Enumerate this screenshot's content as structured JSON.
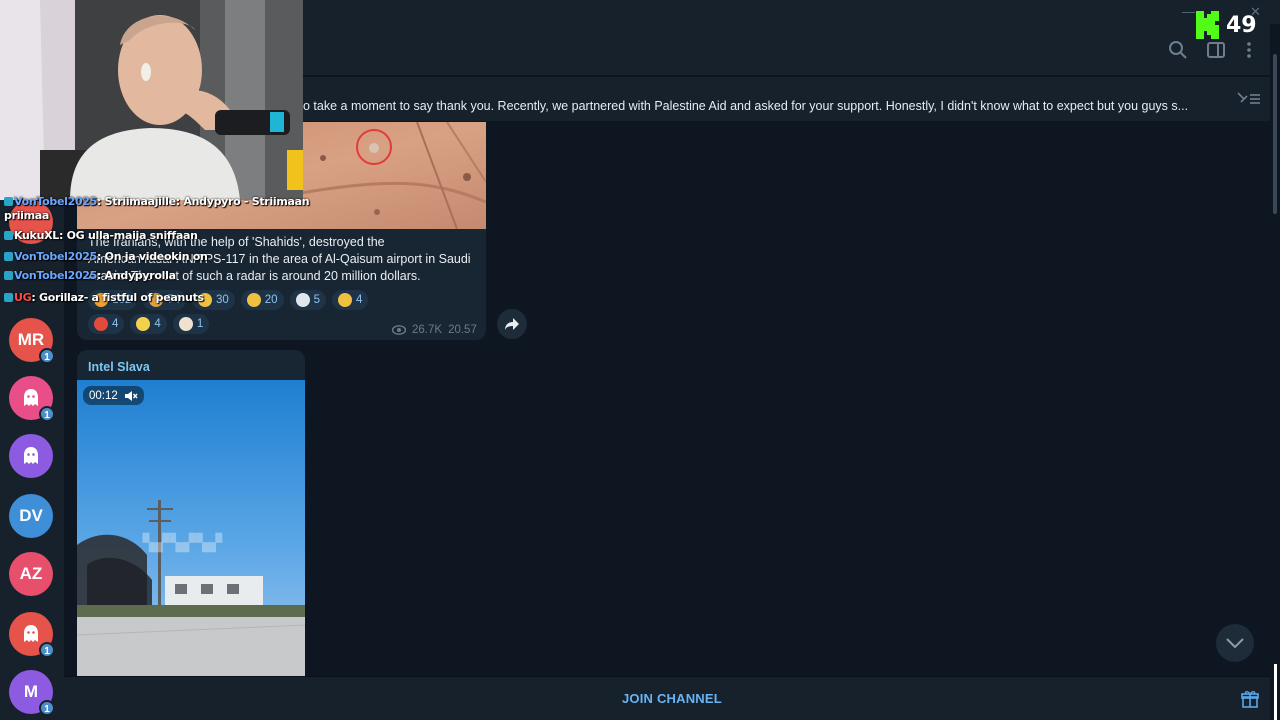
{
  "kick": {
    "viewer_count": "49",
    "logo_icon": "kick-logo-icon",
    "accent": "#53fc18"
  },
  "pinned": {
    "text": "o take a moment to say thank you. Recently, we partnered with Palestine Aid and asked for your support. Honestly, I didn't know what to expect  but you guys s..."
  },
  "header_icons": [
    "search-icon",
    "sidebar-toggle-icon",
    "more-vertical-icon"
  ],
  "sidebar": {
    "avatars": [
      {
        "initials": "",
        "color": "#e5534b",
        "badge": ""
      },
      {
        "initials": "MR",
        "color": "#e5534b",
        "badge": "1"
      },
      {
        "initials": "",
        "color": "#e84f88",
        "badge": "1",
        "icon": "ghost-icon"
      },
      {
        "initials": "",
        "color": "#8c5be2",
        "badge": "",
        "icon": "ghost-icon"
      },
      {
        "initials": "DV",
        "color": "#3f8ed8",
        "badge": ""
      },
      {
        "initials": "AZ",
        "color": "#e84f6d",
        "badge": ""
      },
      {
        "initials": "",
        "color": "#e5534b",
        "badge": "1",
        "icon": "ghost-icon"
      },
      {
        "initials": "M",
        "color": "#8c5be2",
        "badge": "1"
      }
    ]
  },
  "message1": {
    "text_line1": "The Iranians, with the help of 'Shahids', destroyed the",
    "text_line2": "American radar AN/TPS-117 in the area of Al-Qaisum airport in Saudi",
    "text_line3": "Arabia. The cost of such a radar is around 20 million dollars.",
    "reactions_row1": [
      {
        "emoji": "fire-emoji",
        "count": "162",
        "color": "#f0a030"
      },
      {
        "emoji": "party-emoji",
        "count": "74",
        "color": "#e0a040"
      },
      {
        "emoji": "clap-emoji",
        "count": "30",
        "color": "#f0c040"
      },
      {
        "emoji": "thumbs-up-emoji",
        "count": "20",
        "color": "#f0c040"
      },
      {
        "emoji": "dove-emoji",
        "count": "5",
        "color": "#dfe6ec"
      },
      {
        "emoji": "thumbs-down-emoji",
        "count": "4",
        "color": "#f0c040"
      }
    ],
    "reactions_row2": [
      {
        "emoji": "angry-emoji",
        "count": "4",
        "color": "#e24a3b"
      },
      {
        "emoji": "banana-emoji",
        "count": "4",
        "color": "#f2d24a"
      },
      {
        "emoji": "clown-emoji",
        "count": "1",
        "color": "#f0e0d0"
      }
    ],
    "views": "26.7K",
    "time": "20.57"
  },
  "message2": {
    "sender": "Intel Slava",
    "video_duration": "00:12"
  },
  "bottom": {
    "join_label": "JOIN CHANNEL"
  },
  "stream_chat": [
    {
      "user": "VonTobel2025",
      "text": ": Striimaajille: Andypyro - Striimaan",
      "user_color": "blue"
    },
    {
      "user": "",
      "text": "priimaa",
      "user_color": "white"
    },
    {
      "user": "KukuXL",
      "text": ": OG ulla-maija sniffaan",
      "user_color": "white"
    },
    {
      "user": "VonTobel2025",
      "text": ": On ja videokin on",
      "user_color": "blue"
    },
    {
      "user": "VonTobel2025",
      "text": ": Andypyrolla",
      "user_color": "blue"
    },
    {
      "user": "UG",
      "text": ": Gorillaz- a fistful of peanuts",
      "user_color": "red"
    }
  ]
}
